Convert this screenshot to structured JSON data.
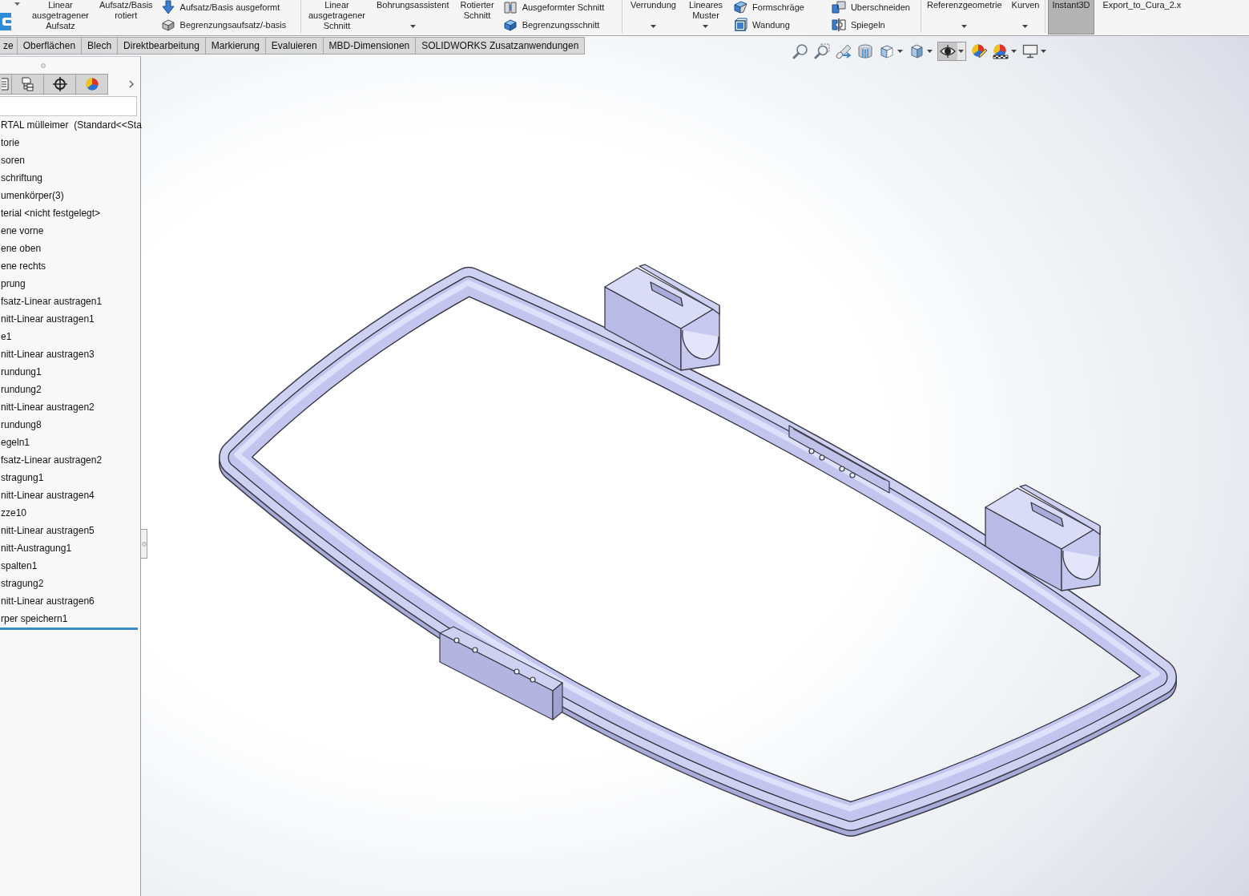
{
  "ribbon": {
    "groups": [
      {
        "items": [
          {
            "kind": "large",
            "label": "Linear ausgetragener Aufsatz",
            "dropdown": false
          },
          {
            "kind": "large",
            "label": "Aufsatz/Basis rotiert",
            "dropdown": false
          },
          {
            "kind": "stack",
            "buttons": [
              {
                "label": "Aufsatz/Basis ausgeformt"
              },
              {
                "label": "Begrenzungsaufsatz/-basis"
              }
            ]
          }
        ]
      },
      {
        "items": [
          {
            "kind": "large",
            "label": "Linear ausgetragener Schnitt",
            "dropdown": false
          },
          {
            "kind": "large",
            "label": "Bohrungsassistent",
            "dropdown": true
          },
          {
            "kind": "large",
            "label": "Rotierter Schnitt",
            "dropdown": false
          },
          {
            "kind": "stack",
            "buttons": [
              {
                "label": "Ausgeformter Schnitt"
              },
              {
                "label": "Begrenzungsschnitt"
              }
            ]
          }
        ]
      },
      {
        "items": [
          {
            "kind": "large",
            "label": "Verrundung",
            "dropdown": true
          },
          {
            "kind": "large",
            "label": "Lineares Muster",
            "dropdown": true
          },
          {
            "kind": "stack",
            "buttons": [
              {
                "label": "Formschräge"
              },
              {
                "label": "Wandung"
              }
            ]
          },
          {
            "kind": "stack",
            "buttons": [
              {
                "label": "Uberschneiden"
              },
              {
                "label": "Spiegeln"
              }
            ]
          }
        ]
      },
      {
        "items": [
          {
            "kind": "large",
            "label": "Referenzgeometrie",
            "dropdown": true
          },
          {
            "kind": "large",
            "label": "Kurven",
            "dropdown": true
          }
        ]
      },
      {
        "items": [
          {
            "kind": "toggle",
            "label": "Instant3D",
            "on": true
          },
          {
            "kind": "large",
            "label": "Export_to_Cura_2.x",
            "dropdown": false
          }
        ]
      }
    ]
  },
  "command_tabs": [
    {
      "label": "ze",
      "selected": false
    },
    {
      "label": "Oberflächen",
      "selected": false
    },
    {
      "label": "Blech",
      "selected": false
    },
    {
      "label": "Direktbearbeitung",
      "selected": false
    },
    {
      "label": "Markierung",
      "selected": false
    },
    {
      "label": "Evaluieren",
      "selected": false
    },
    {
      "label": "MBD-Dimensionen",
      "selected": false
    },
    {
      "label": "SOLIDWORKS Zusatzanwendungen",
      "selected": false
    }
  ],
  "view_toolbar": [
    {
      "on": false,
      "dropdown": false
    },
    {
      "on": false,
      "dropdown": false
    },
    {
      "on": false,
      "dropdown": false
    },
    {
      "on": false,
      "dropdown": false
    },
    {
      "on": false,
      "dropdown": true
    },
    {
      "on": false,
      "dropdown": true
    },
    {
      "on": true,
      "dropdown": true
    },
    {
      "on": false,
      "dropdown": false
    },
    {
      "on": false,
      "dropdown": true
    },
    {
      "on": false,
      "dropdown": true
    }
  ],
  "feature_tree": {
    "items": [
      {
        "label": "RTAL mülleimer  (Standard<<Sta"
      },
      {
        "label": "torie"
      },
      {
        "label": "soren"
      },
      {
        "label": "schriftung"
      },
      {
        "label": "umenkörper(3)"
      },
      {
        "label": "terial <nicht festgelegt>"
      },
      {
        "label": "ene vorne"
      },
      {
        "label": "ene oben"
      },
      {
        "label": "ene rechts"
      },
      {
        "label": "prung"
      },
      {
        "label": "fsatz-Linear austragen1"
      },
      {
        "label": "nitt-Linear austragen1"
      },
      {
        "label": "e1"
      },
      {
        "label": "nitt-Linear austragen3"
      },
      {
        "label": "rundung1"
      },
      {
        "label": "rundung2"
      },
      {
        "label": "nitt-Linear austragen2"
      },
      {
        "label": "rundung8"
      },
      {
        "label": "egeln1"
      },
      {
        "label": "fsatz-Linear austragen2"
      },
      {
        "label": "stragung1"
      },
      {
        "label": "nitt-Linear austragen4"
      },
      {
        "label": "zze10"
      },
      {
        "label": "nitt-Linear austragen5"
      },
      {
        "label": "nitt-Austragung1"
      },
      {
        "label": "spalten1"
      },
      {
        "label": "stragung2"
      },
      {
        "label": "nitt-Linear austragen6"
      },
      {
        "label": "rper speichern1"
      }
    ]
  }
}
